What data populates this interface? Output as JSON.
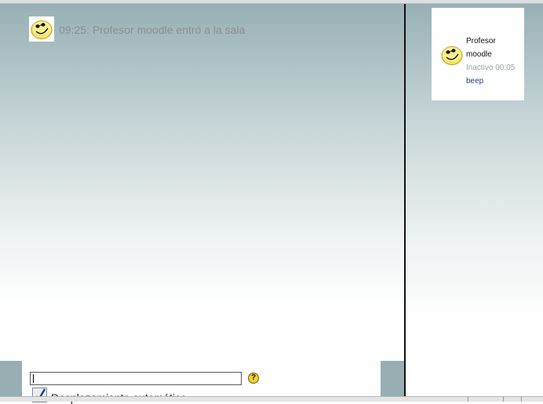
{
  "chat": {
    "messages": [
      {
        "time_text": "09:25: Profesor moodle entró a la sala",
        "avatar_icon": "smiley-icon"
      }
    ]
  },
  "users": {
    "list": [
      {
        "name_line1": "Profesor",
        "name_line2": "moodle",
        "idle": "Inactivo 00:05",
        "beep": "beep",
        "avatar_icon": "smiley-icon"
      }
    ]
  },
  "input": {
    "value": "",
    "help_label": "?",
    "autoscroll_label": "Desplazamiento automático",
    "autoscroll_checked": true
  },
  "colors": {
    "panel_top": "#98b0b4",
    "link": "#1d3f87",
    "muted_text": "#8a8f92"
  }
}
